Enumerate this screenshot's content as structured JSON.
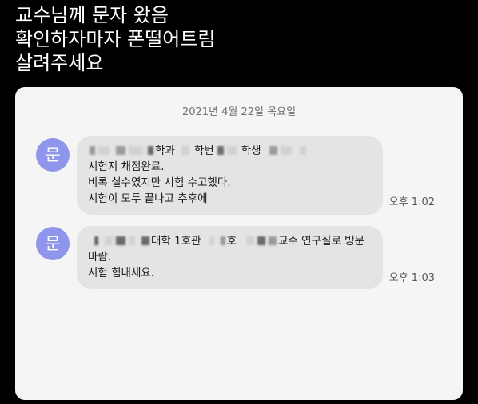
{
  "caption": {
    "line1": "교수님께 문자 왔음",
    "line2": "확인하자마자 폰떨어트림",
    "line3": "살려주세요"
  },
  "conversation": {
    "date": "2021년 4월 22일 목요일",
    "messages": [
      {
        "avatar": "문",
        "line1_part1": "학과",
        "line1_part2": "학번",
        "line1_part3": "학생",
        "line2": "시험지 채점완료.",
        "line3": "비록 실수였지만 시험 수고했다.",
        "line4": "시험이 모두 끝나고 추후에",
        "time": "오후 1:02"
      },
      {
        "avatar": "문",
        "line1_part1": "대학 1호관",
        "line1_part2": "호",
        "line1_part3": "교수 연구실로 방문",
        "line2": "바람.",
        "line3": "시험 힘내세요.",
        "time": "오후 1:03"
      }
    ]
  },
  "colors": {
    "background": "#000000",
    "card": "#f5f5f5",
    "bubble": "#e4e4e4",
    "avatar": "#8e95ea"
  }
}
